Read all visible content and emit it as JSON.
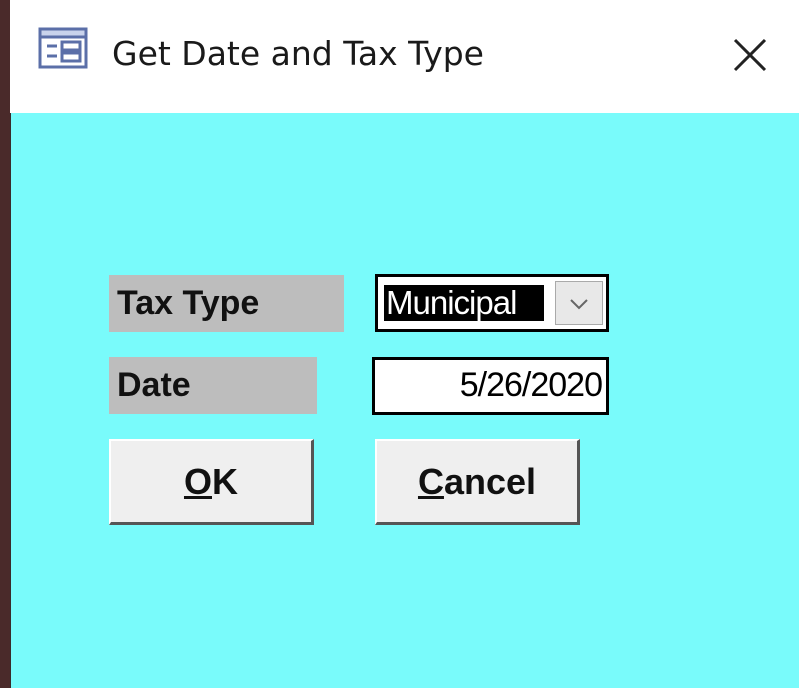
{
  "window": {
    "title": "Get Date and Tax Type",
    "icon": "form-icon",
    "close_icon": "close-icon"
  },
  "colors": {
    "client_background": "#79fbfb",
    "label_background": "#bdbdbd",
    "button_face": "#efefef"
  },
  "form": {
    "tax_type_label": "Tax Type",
    "tax_type_value": "Municipal",
    "date_label": "Date",
    "date_value": "5/26/2020",
    "ok_button": {
      "accel": "O",
      "rest": "K"
    },
    "cancel_button": {
      "accel": "C",
      "rest": "ancel"
    }
  }
}
